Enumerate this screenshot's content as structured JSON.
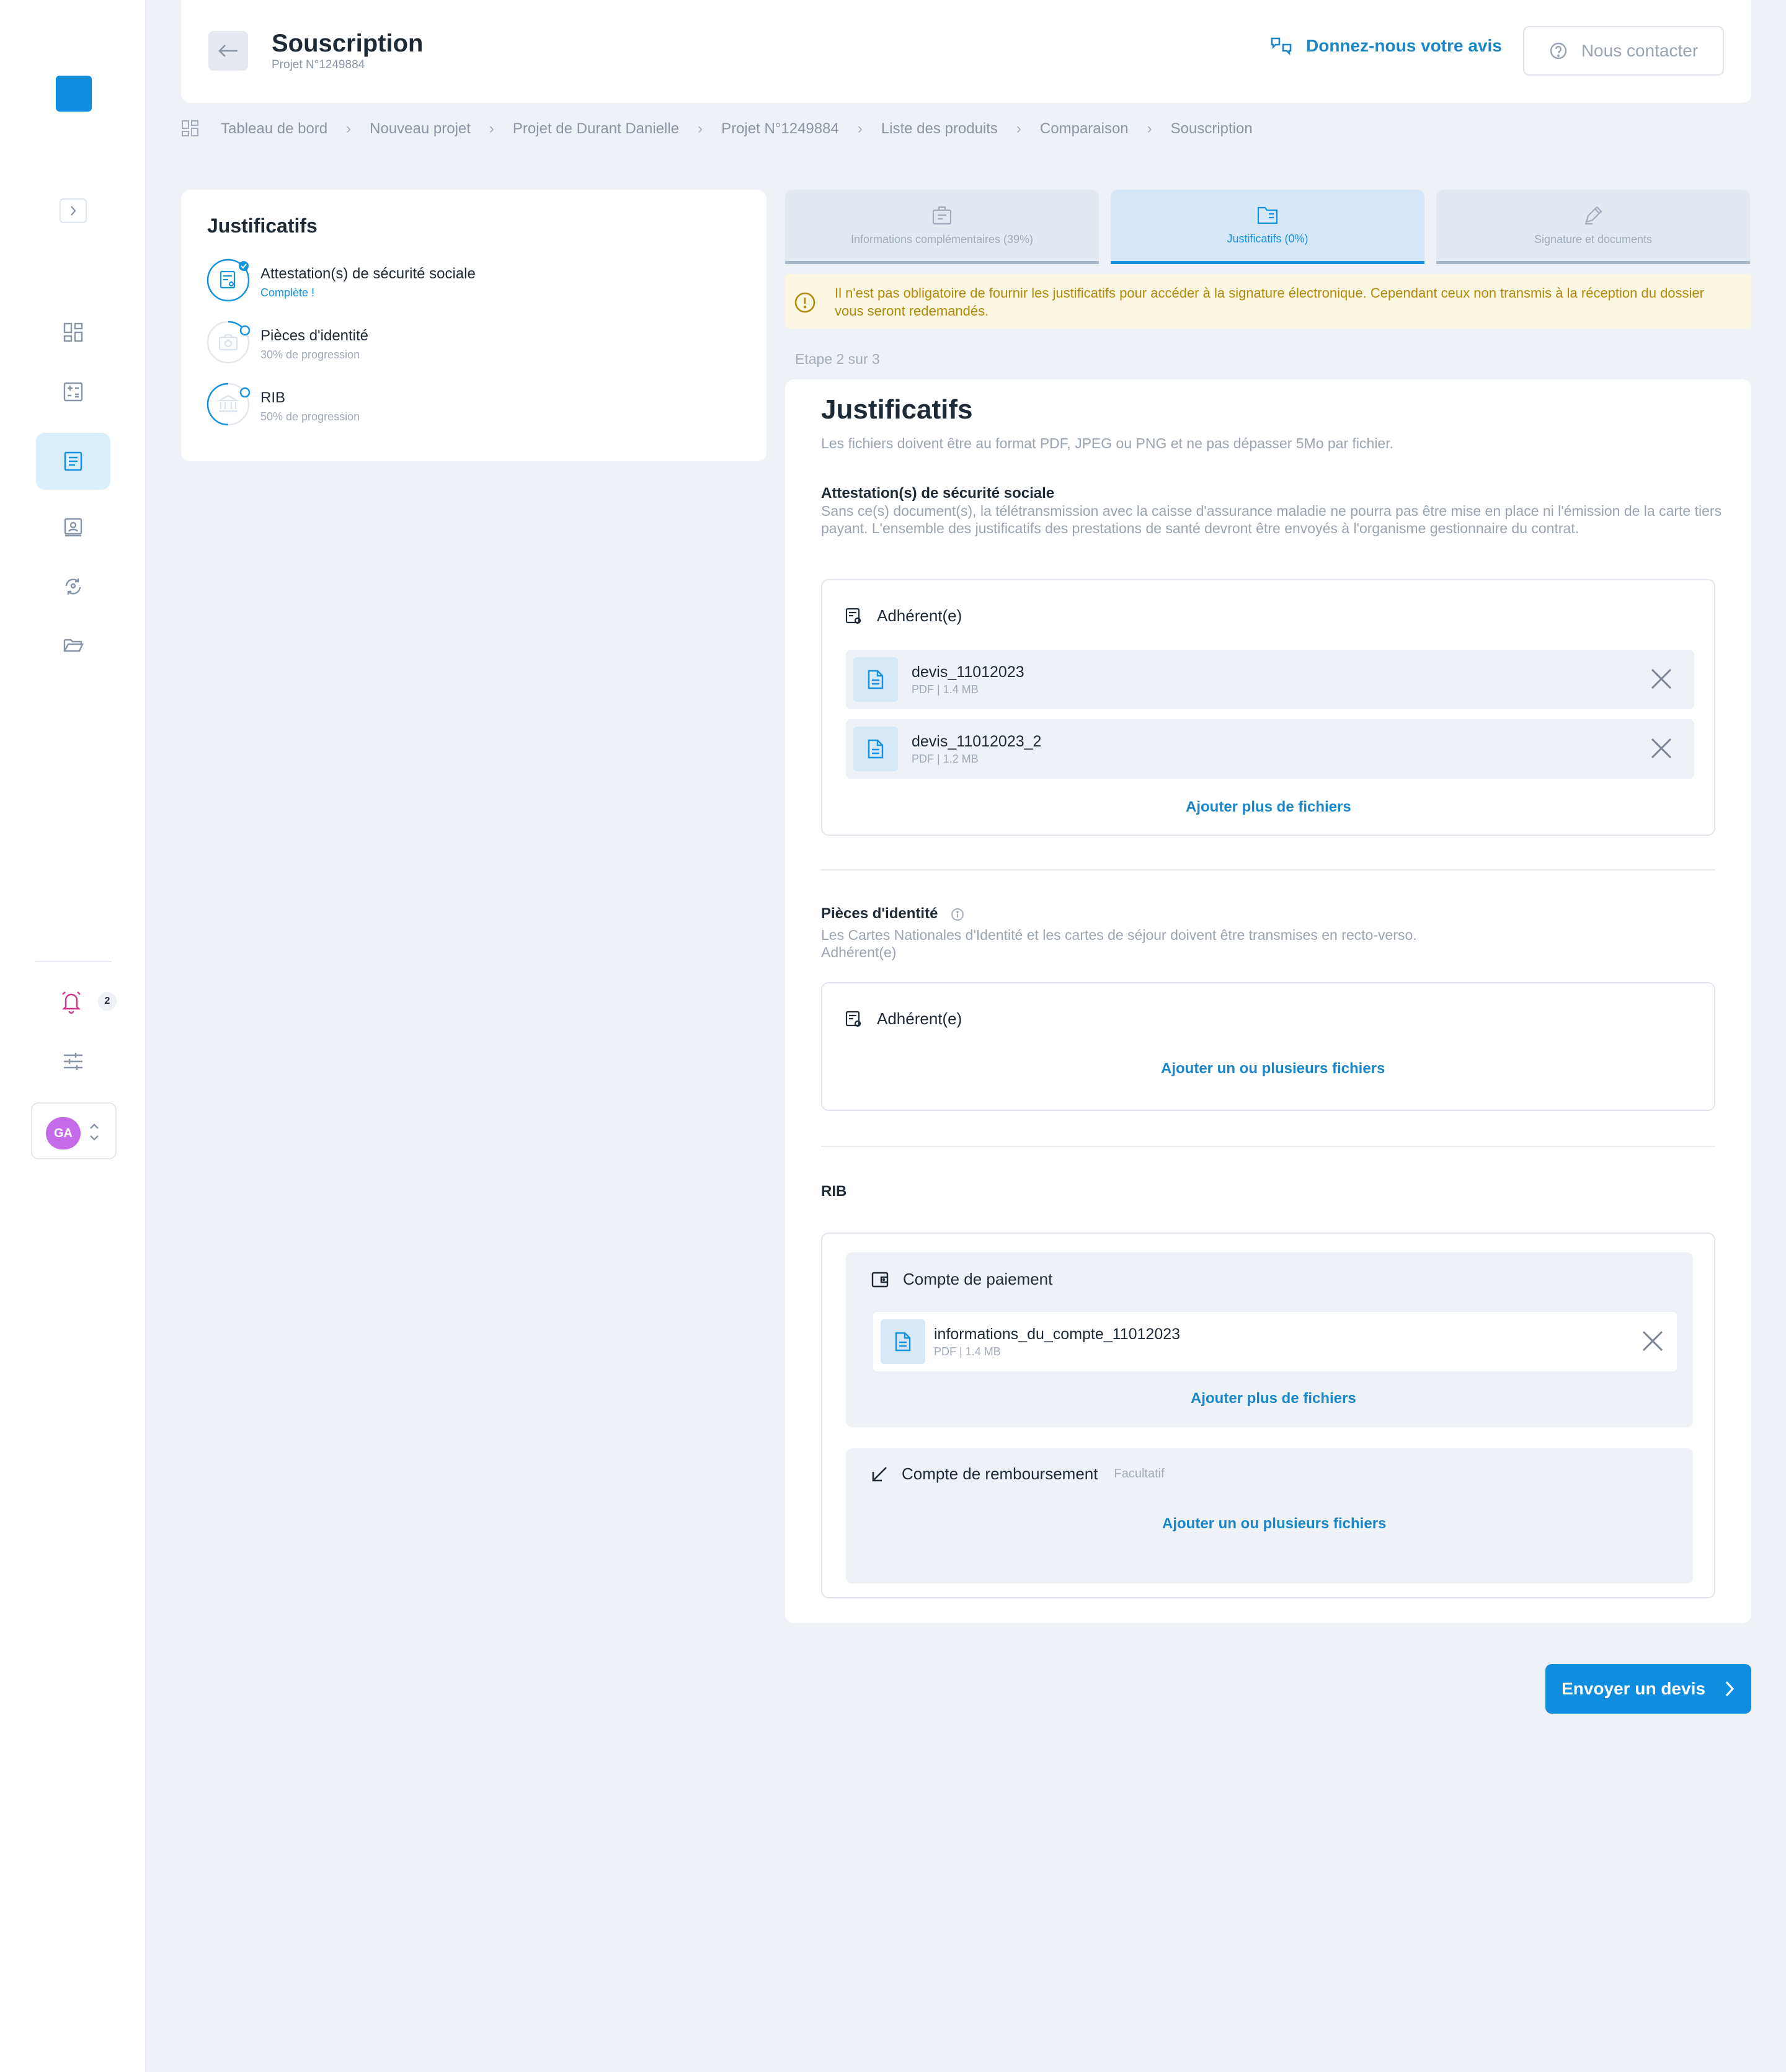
{
  "header": {
    "title": "Souscription",
    "subtitle": "Projet N°1249884",
    "feedback_label": "Donnez-nous votre avis",
    "contact_label": "Nous contacter"
  },
  "breadcrumb": [
    "Tableau de bord",
    "Nouveau projet",
    "Projet de Durant Danielle",
    "Projet N°1249884",
    "Liste des produits",
    "Comparaison",
    "Souscription"
  ],
  "sidebar": {
    "notification_count": "2",
    "user_initials": "GA"
  },
  "left_panel": {
    "title": "Justificatifs",
    "steps": [
      {
        "label": "Attestation(s) de sécurité sociale",
        "status": "Complète !",
        "progress": 1.0
      },
      {
        "label": "Pièces d'identité",
        "status": "30% de progression",
        "progress": 0.3
      },
      {
        "label": "RIB",
        "status": "50% de progression",
        "progress": 0.5
      }
    ]
  },
  "tabs": [
    {
      "label": "Informations complémentaires (39%)",
      "active": false
    },
    {
      "label": "Justificatifs (0%)",
      "active": true
    },
    {
      "label": "Signature et documents",
      "active": false
    }
  ],
  "alert": {
    "text": "Il n'est pas obligatoire de fournir les justificatifs pour accéder à la signature électronique. Cependant ceux non transmis à la réception du dossier vous seront redemandés."
  },
  "step_counter": "Etape 2 sur 3",
  "main": {
    "title": "Justificatifs",
    "subtitle": "Les fichiers doivent être au format PDF, JPEG ou PNG et ne pas dépasser 5Mo par fichier.",
    "securite_sociale": {
      "title": "Attestation(s) de sécurité sociale",
      "description": "Sans ce(s) document(s), la télétransmission avec la caisse d'assurance maladie ne pourra pas être mise en place ni l'émission de la carte tiers payant. L'ensemble des justificatifs des prestations de santé devront être envoyés à l'organisme gestionnaire du contrat.",
      "box_label": "Adhérent(e)",
      "files": [
        {
          "name": "devis_11012023",
          "meta": "PDF | 1.4 MB"
        },
        {
          "name": "devis_11012023_2",
          "meta": "PDF | 1.2 MB"
        }
      ],
      "add_label": "Ajouter plus de fichiers"
    },
    "identite": {
      "title": "Pièces d'identité",
      "description_line1": "Les Cartes Nationales d'Identité et les cartes de séjour doivent être transmises en recto-verso.",
      "description_line2": "Adhérent(e)",
      "box_label": "Adhérent(e)",
      "add_label": "Ajouter un ou plusieurs fichiers"
    },
    "rib": {
      "title": "RIB",
      "paiement": {
        "label": "Compte de paiement",
        "file": {
          "name": "informations_du_compte_11012023",
          "meta": "PDF | 1.4 MB"
        },
        "add_label": "Ajouter plus de fichiers"
      },
      "remboursement": {
        "label": "Compte de remboursement",
        "optional": "Facultatif",
        "add_label": "Ajouter un ou plusieurs fichiers"
      }
    }
  },
  "footer": {
    "send_label": "Envoyer un devis"
  },
  "colors": {
    "accent": "#0f8ee0",
    "link": "#1a86c7",
    "alert_bg": "#fbf6e2",
    "alert_text": "#b28a08",
    "avatar": "#c56bea"
  }
}
